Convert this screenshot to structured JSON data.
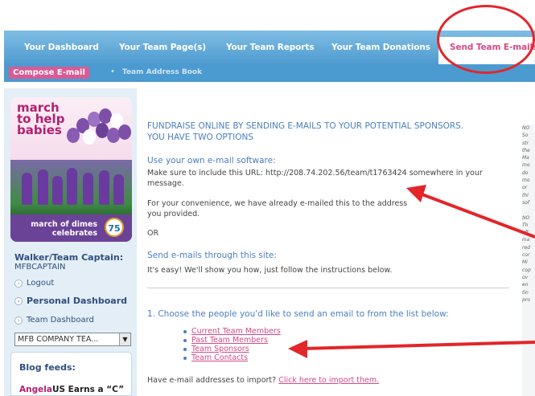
{
  "topnav": {
    "tabs": [
      {
        "label": "Your Dashboard"
      },
      {
        "label": "Your Team Page(s)"
      },
      {
        "label": "Your Team Reports"
      },
      {
        "label": "Your Team Donations"
      },
      {
        "label": "Send Team E-mails"
      }
    ],
    "active_tab": "Send Team E-mails"
  },
  "subnav": {
    "compose_label": "Compose E-mail",
    "address_book_label": "Team Address Book"
  },
  "promo": {
    "headline": [
      "march",
      "to help",
      "babies"
    ],
    "tagline": [
      "march of dimes",
      "celebrates"
    ],
    "badge": "75"
  },
  "sidebar": {
    "captain_title": "Walker/Team Captain:",
    "captain_name": "MFBCAPTAIN",
    "logout_label": "Logout",
    "personal_dashboard_label": "Personal Dashboard",
    "team_dashboard_label": "Team Dashboard",
    "team_select_value": "MFB COMPANY TEA...",
    "blog_title": "Blog feeds:",
    "blog_entry_author": "Angela",
    "blog_entry_text": "US Earns a “C”"
  },
  "main": {
    "heading_line1": "FUNDRAISE ONLINE BY SENDING E-MAILS TO YOUR POTENTIAL SPONSORS.",
    "heading_line2": "YOU HAVE TWO OPTIONS",
    "option1_title": "Use your own e-mail software:",
    "option1_text_line1": "Make sure to include this URL: http://208.74.202.56/team/t1763424 somewhere in your",
    "option1_text_line2": "message.",
    "convenience_line1": "For your convenience, we have already e-mailed this to the address",
    "convenience_line2": "you provided.",
    "or_label": "OR",
    "option2_title": "Send e-mails through this site:",
    "option2_text": "It's easy! We'll show you how, just follow the instructions below.",
    "step1_title": "1. Choose the people you'd like to send an email to from the list below:",
    "recipient_links": [
      "Current Team Members",
      "Past Team Members",
      "Team Sponsors",
      "Team Contacts"
    ],
    "import_prefix": "Have e-mail addresses to import?",
    "import_link": "Click here to import them."
  },
  "right_panel_lines": [
    "NO",
    "So",
    "str",
    "the",
    "Ma",
    "mo",
    "do",
    "mo",
    "or",
    "thi",
    "sof",
    "",
    "NO",
    "Th",
    "aft",
    "ina",
    "red",
    "cor",
    "Mi",
    "cop",
    "ov",
    "en",
    "tin",
    "pro"
  ],
  "colors": {
    "nav_blue": "#4f9bd0",
    "accent_pink": "#d44a86",
    "heading_blue": "#4a7fbf",
    "annotation_red": "#e2262a"
  }
}
